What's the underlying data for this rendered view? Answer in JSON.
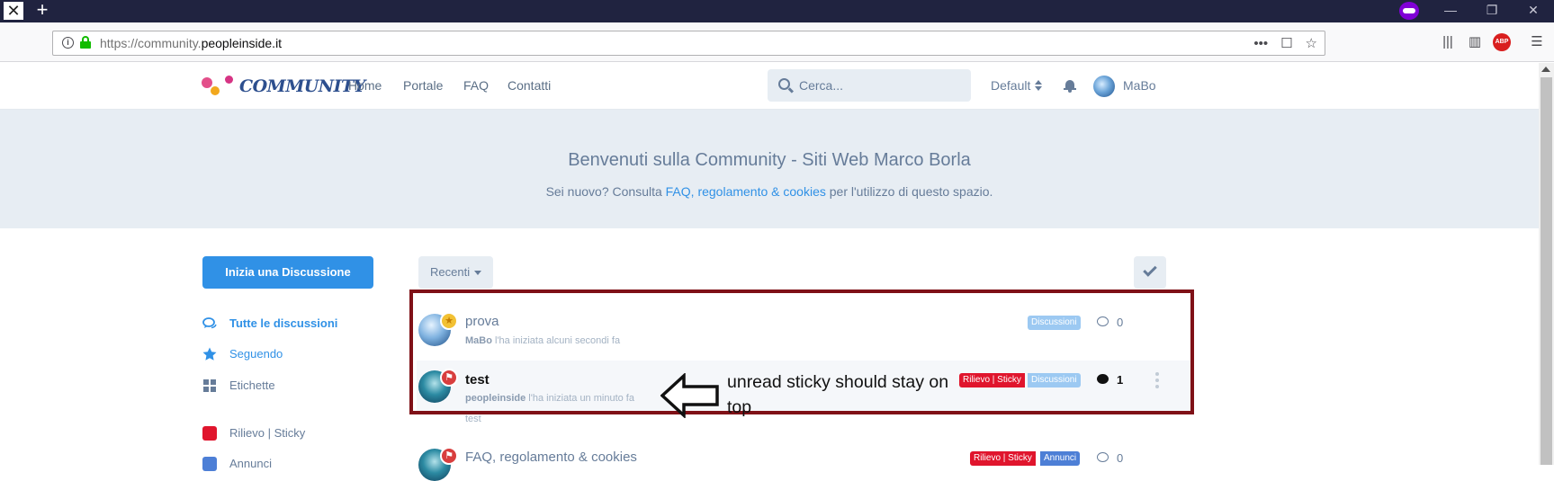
{
  "browser": {
    "tab_close_glyph": "✕",
    "new_tab_glyph": "+",
    "url_prefix": "https://community.",
    "url_domain": "peopleinside.it",
    "url_actions": [
      "•••",
      "☐",
      "☆"
    ],
    "window_buttons": [
      "—",
      "❐",
      "✕"
    ],
    "toolbar_icons": [
      "library-icon",
      "sidebar-icon",
      "adblock-plus-icon",
      "hamburger-menu-icon"
    ],
    "abp_label": "ABP",
    "menu_glyph": "☰"
  },
  "header": {
    "logo_text": "COMMUNITY",
    "nav": [
      "Home",
      "Portale",
      "FAQ",
      "Contatti"
    ],
    "search_placeholder": "Cerca...",
    "theme": "Default",
    "username": "MaBo"
  },
  "hero": {
    "title": "Benvenuti sulla Community - Siti Web Marco Borla",
    "sub_prefix": "Sei nuovo? Consulta ",
    "sub_link": "FAQ, regolamento & cookies",
    "sub_suffix": " per l'utilizzo di questo spazio."
  },
  "sidebar": {
    "start_button": "Inizia una Discussione",
    "items": [
      {
        "label": "Tutte le discussioni",
        "icon": "comments-icon"
      },
      {
        "label": "Seguendo",
        "icon": "star-icon"
      },
      {
        "label": "Etichette",
        "icon": "tags-grid-icon"
      },
      {
        "label": "Rilievo | Sticky",
        "icon": "tag-color-square",
        "color": "#e0152d"
      },
      {
        "label": "Annunci",
        "icon": "tag-color-square",
        "color": "#4d7fd6"
      }
    ]
  },
  "list": {
    "sort_label": "Recenti",
    "discussions": [
      {
        "title": "prova",
        "author": "MaBo",
        "meta": " l'ha iniziata alcuni secondi fa",
        "tags": [
          "Discussioni"
        ],
        "replies": "0",
        "unread": false,
        "badge": "star"
      },
      {
        "title": "test",
        "author": "peopleinside",
        "meta": " l'ha iniziata un minuto fa",
        "excerpt": "test",
        "tags": [
          "Rilievo | Sticky",
          "Discussioni"
        ],
        "replies": "1",
        "unread": true,
        "badge": "pin"
      },
      {
        "title": "FAQ, regolamento & cookies",
        "tags": [
          "Rilievo | Sticky",
          "Annunci"
        ],
        "replies": "0",
        "unread": false,
        "badge": "pin"
      }
    ]
  },
  "annotation": {
    "text": "unread sticky should stay on top",
    "color": "#7f1117"
  },
  "colors": {
    "accent": "#3091e6",
    "hero_bg": "#e7edf3",
    "sticky_red": "#e0152d",
    "announce_blue": "#4d7fd6",
    "discussion_tag": "#9cc9f2"
  }
}
